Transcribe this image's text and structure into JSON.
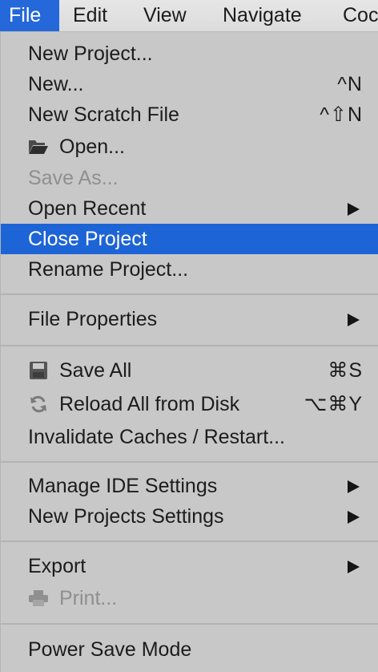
{
  "menubar": {
    "items": [
      "File",
      "Edit",
      "View",
      "Navigate",
      "Coc"
    ]
  },
  "menu": {
    "new_project": "New Project...",
    "new": "New...",
    "new_shortcut": "^N",
    "new_scratch": "New Scratch File",
    "new_scratch_shortcut": "^⇧N",
    "open": "Open...",
    "save_as": "Save As...",
    "open_recent": "Open Recent",
    "close_project": "Close Project",
    "rename_project": "Rename Project...",
    "file_properties": "File Properties",
    "save_all": "Save All",
    "save_all_shortcut": "⌘S",
    "reload_all": "Reload All from Disk",
    "reload_all_shortcut": "⌥⌘Y",
    "invalidate_caches": "Invalidate Caches / Restart...",
    "manage_ide_settings": "Manage IDE Settings",
    "new_projects_settings": "New Projects Settings",
    "export": "Export",
    "print": "Print...",
    "power_save_mode": "Power Save Mode"
  },
  "icons": {
    "open": "folder-icon",
    "save_all": "floppy-disk-icon",
    "reload_all": "refresh-icon",
    "print": "printer-icon"
  },
  "colors": {
    "menu_background": "#c8c8c8",
    "highlight": "#1d64d6",
    "active_menubar": "#2468d9",
    "disabled_text": "#8f8f8f"
  }
}
